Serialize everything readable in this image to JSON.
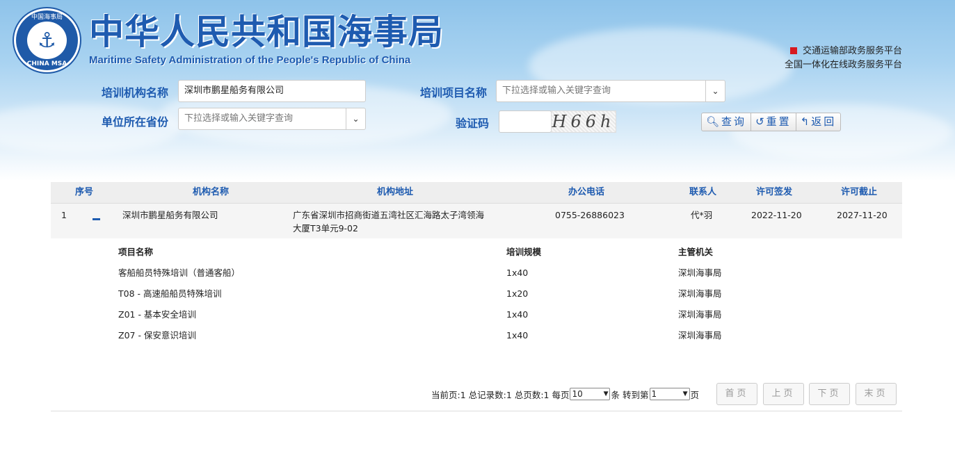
{
  "header": {
    "title": "中华人民共和国海事局",
    "subtitle": "Maritime Safety Administration of the People's Republic of China",
    "logo_top_text": "中国海事局",
    "logo_bottom_text": "CHINA MSA",
    "platform_line1": "交通运输部政务服务平台",
    "platform_line2": "全国一体化在线政务服务平台",
    "brand_color": "#1e5bb0",
    "accent_red": "#d71920"
  },
  "search": {
    "org_label": "培训机构名称",
    "org_value": "深圳市鹏星船务有限公司",
    "project_label": "培训项目名称",
    "project_placeholder": "下拉选择或输入关键字查询",
    "province_label": "单位所在省份",
    "province_placeholder": "下拉选择或输入关键字查询",
    "captcha_label": "验证码",
    "captcha_text": "H66h",
    "query_button": "查询",
    "reset_button": "重置",
    "back_button": "返回"
  },
  "table": {
    "headers": {
      "index": "序号",
      "name": "机构名称",
      "address": "机构地址",
      "phone": "办公电话",
      "contact": "联系人",
      "issue_date": "许可签发",
      "expiry_date": "许可截止"
    },
    "rows": [
      {
        "index": "1",
        "name": "深圳市鹏星船务有限公司",
        "address_line1": "广东省深圳市招商街道五湾社区汇海路太子湾领海",
        "address_line2": "大厦T3单元9-02",
        "phone": "0755-26886023",
        "contact": "代*羽",
        "issue_date": "2022-11-20",
        "expiry_date": "2027-11-20"
      }
    ],
    "detail": {
      "headers": {
        "project": "项目名称",
        "scale": "培训规模",
        "authority": "主管机关"
      },
      "items": [
        {
          "project": "客船船员特殊培训（普通客船）",
          "scale": "1x40",
          "authority": "深圳海事局"
        },
        {
          "project": "T08 - 高速船船员特殊培训",
          "scale": "1x20",
          "authority": "深圳海事局"
        },
        {
          "project": "Z01 - 基本安全培训",
          "scale": "1x40",
          "authority": "深圳海事局"
        },
        {
          "project": "Z07 - 保安意识培训",
          "scale": "1x40",
          "authority": "深圳海事局"
        }
      ]
    }
  },
  "pager": {
    "current_page": "当前页:1",
    "total_records": "总记录数:1",
    "total_pages": "总页数:1",
    "per_page_label": "每页",
    "per_page_value": "10",
    "per_page_unit": "条",
    "goto_label": "转到第",
    "goto_value": "1",
    "goto_unit": "页",
    "first": "首页",
    "prev": "上页",
    "next": "下页",
    "last": "末页"
  }
}
